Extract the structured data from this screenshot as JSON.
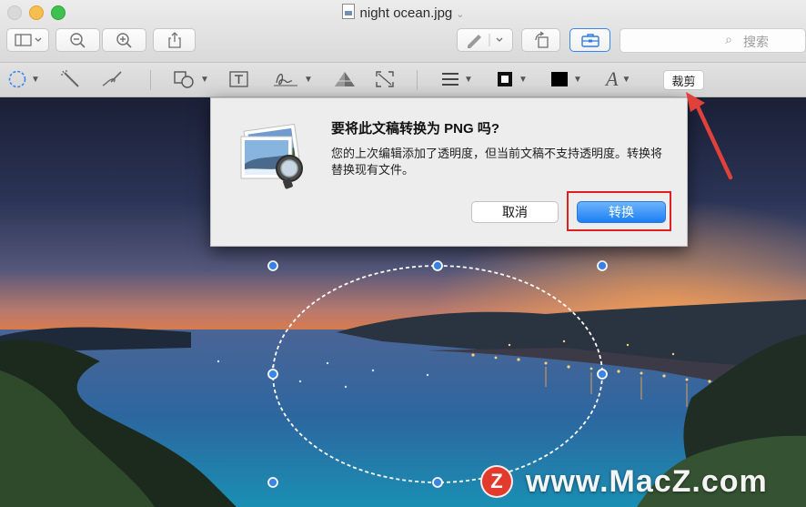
{
  "window": {
    "title": "night ocean.jpg",
    "title_chevron": "⌄",
    "traffic_lights": [
      "close",
      "minimize",
      "zoom"
    ]
  },
  "toolbar": {
    "search_placeholder": "搜索",
    "icons": [
      "sidebar-icon",
      "zoom-out-icon",
      "zoom-in-icon",
      "share-icon",
      "pen-icon",
      "rotate-icon",
      "toolbox-icon"
    ]
  },
  "markup_bar": {
    "crop_label": "裁剪",
    "font_glyph": "A"
  },
  "dialog": {
    "title": "要将此文稿转换为 PNG 吗?",
    "message": "您的上次编辑添加了透明度，但当前文稿不支持透明度。转换将替换现有文件。",
    "cancel_label": "取消",
    "convert_label": "转换"
  },
  "watermark": {
    "logo_letter": "Z",
    "text": "www.MacZ.com"
  },
  "colors": {
    "accent_blue": "#1d7ff5",
    "highlight_red": "#e02020",
    "arrow_red": "#e0413a",
    "selection_handle": "#3a86e8"
  }
}
